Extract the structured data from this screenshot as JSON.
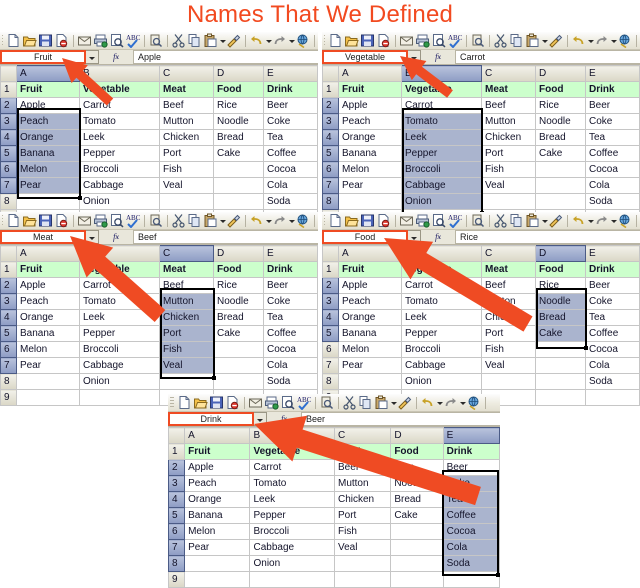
{
  "title": "Names That We Defined",
  "title_color": "#f24a20",
  "accent_color": "#ef4b23",
  "header_fill": "#ccffcc",
  "selection_fill": "#aab4ce",
  "columns": [
    "A",
    "B",
    "C",
    "D",
    "E"
  ],
  "row_numbers": [
    "1",
    "2",
    "3",
    "4",
    "5",
    "6",
    "7",
    "8",
    "9"
  ],
  "sheet": {
    "header_row": [
      "Fruit",
      "Vegetable",
      "Meat",
      "Food",
      "Drink"
    ],
    "rows": [
      [
        "Apple",
        "Carrot",
        "Beef",
        "Rice",
        "Beer"
      ],
      [
        "Peach",
        "Tomato",
        "Mutton",
        "Noodle",
        "Coke"
      ],
      [
        "Orange",
        "Leek",
        "Chicken",
        "Bread",
        "Tea"
      ],
      [
        "Banana",
        "Pepper",
        "Port",
        "Cake",
        "Coffee"
      ],
      [
        "Melon",
        "Broccoli",
        "Fish",
        "",
        "Cocoa"
      ],
      [
        "Pear",
        "Cabbage",
        "Veal",
        "",
        "Cola"
      ],
      [
        "",
        "Onion",
        "",
        "",
        "Soda"
      ],
      [
        "",
        "",
        "",
        "",
        ""
      ]
    ]
  },
  "toolbar": {
    "buttons": [
      "new-icon",
      "open-icon",
      "save-icon",
      "permission-icon",
      "email-icon",
      "print-icon",
      "print-preview-icon",
      "spelling-icon",
      "research-icon",
      "cut-icon",
      "copy-icon",
      "paste-icon",
      "format-painter-icon",
      "undo-icon",
      "redo-icon",
      "insert-hyperlink-icon"
    ]
  },
  "fx_label": "fx",
  "panels": [
    {
      "id": "panel-fruit",
      "name_box_value": "Fruit",
      "formula_value": "Apple",
      "selected_column_index": 0,
      "selected_rows": [
        2,
        3,
        4,
        5,
        6,
        7
      ]
    },
    {
      "id": "panel-vegetable",
      "name_box_value": "Vegetable",
      "formula_value": "Carrot",
      "selected_column_index": 1,
      "selected_rows": [
        2,
        3,
        4,
        5,
        6,
        7,
        8
      ]
    },
    {
      "id": "panel-meat",
      "name_box_value": "Meat",
      "formula_value": "Beef",
      "selected_column_index": 2,
      "selected_rows": [
        2,
        3,
        4,
        5,
        6,
        7
      ]
    },
    {
      "id": "panel-food",
      "name_box_value": "Food",
      "formula_value": "Rice",
      "selected_column_index": 3,
      "selected_rows": [
        2,
        3,
        4,
        5
      ]
    },
    {
      "id": "panel-drink",
      "name_box_value": "Drink",
      "formula_value": "Beer",
      "selected_column_index": 4,
      "selected_rows": [
        2,
        3,
        4,
        5,
        6,
        7,
        8
      ]
    }
  ]
}
